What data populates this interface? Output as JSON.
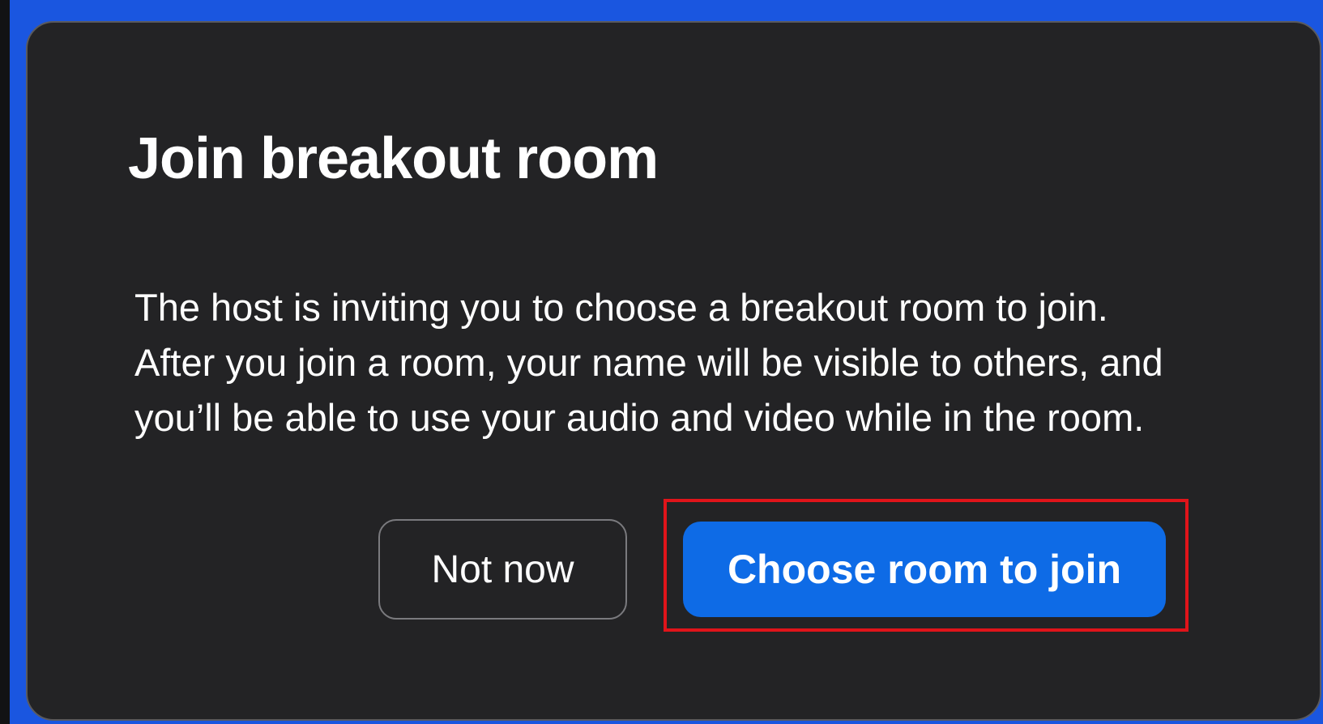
{
  "dialog": {
    "title": "Join breakout room",
    "message": "The host is inviting you to choose a breakout room to join. After you join a room, your name will be visible to others, and you’ll be able to use your audio and video while in the room.",
    "buttons": {
      "secondary_label": "Not now",
      "primary_label": "Choose room to join"
    }
  },
  "colors": {
    "dialog_background": "#232325",
    "primary_button": "#0e6be6",
    "window_frame": "#1a56e0",
    "highlight_outline": "#e0141a"
  }
}
